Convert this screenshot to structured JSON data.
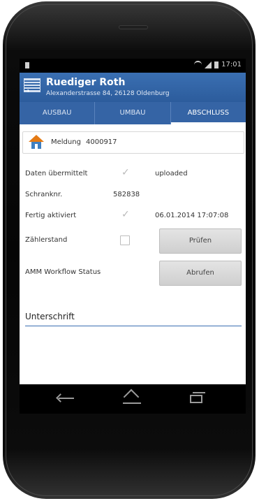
{
  "statusbar": {
    "time": "17:01"
  },
  "actionbar": {
    "title": "Ruediger Roth",
    "subtitle": "Alexanderstrasse 84, 26128 Oldenburg"
  },
  "tabs": [
    {
      "label": "AUSBAU",
      "active": false
    },
    {
      "label": "UMBAU",
      "active": false
    },
    {
      "label": "ABSCHLUSS",
      "active": true
    }
  ],
  "meldung": {
    "label": "Meldung",
    "value": "4000917"
  },
  "rows": {
    "daten": {
      "label": "Daten übermittelt",
      "status": "uploaded"
    },
    "schrank": {
      "label": "Schranknr.",
      "value": "582838"
    },
    "fertig": {
      "label": "Fertig aktiviert",
      "value": "06.01.2014 17:07:08"
    },
    "zaehler": {
      "label": "Zählerstand",
      "button": "Prüfen"
    },
    "workflow": {
      "label": "AMM Workflow Status",
      "button": "Abrufen"
    }
  },
  "signature": {
    "label": "Unterschrift"
  },
  "colors": {
    "accent": "#3564a5",
    "actionbar": "#2c5c9c"
  }
}
